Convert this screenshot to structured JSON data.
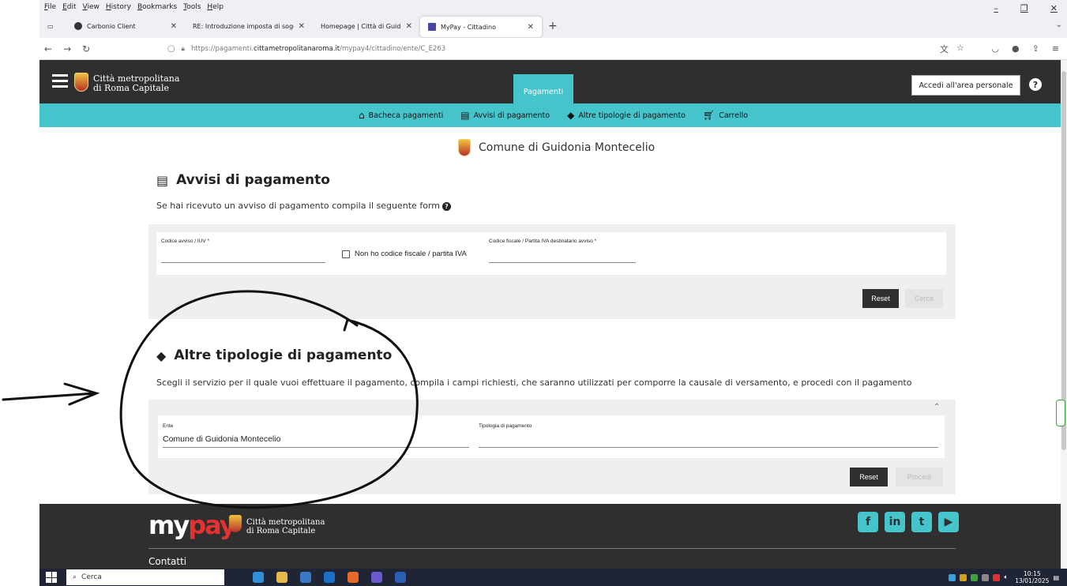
{
  "browser": {
    "menu": [
      "File",
      "Edit",
      "View",
      "History",
      "Bookmarks",
      "Tools",
      "Help"
    ],
    "tabs": [
      {
        "label": "Carbonio Client"
      },
      {
        "label": "RE: Introduzione imposta di soggior"
      },
      {
        "label": "Homepage | Città di Guidonia I"
      },
      {
        "label": "MyPay - Cittadino"
      }
    ],
    "url_prefix": "https://pagamenti.",
    "url_domain": "cittametropolitanaroma.it",
    "url_path": "/mypay4/cittadino/ente/C_E263"
  },
  "header": {
    "brand_line1": "Città metropolitana",
    "brand_line2": "di Roma Capitale",
    "active_tab": "Pagamenti",
    "login_button": "Accedi all'area personale",
    "help": "?"
  },
  "subnav": [
    {
      "label": "Bacheca pagamenti",
      "icon": "home-icon"
    },
    {
      "label": "Avvisi di pagamento",
      "icon": "document-icon"
    },
    {
      "label": "Altre tipologie di pagamento",
      "icon": "tags-icon"
    },
    {
      "label": "Carrello",
      "icon": "cart-icon"
    }
  ],
  "ente_title": "Comune di Guidonia Montecelio",
  "avvisi": {
    "title": "Avvisi di pagamento",
    "subtitle": "Se hai ricevuto un avviso di pagamento compila il seguente form",
    "field1_label": "Codice avviso / IUV *",
    "checkbox_label": "Non ho codice fiscale / partita IVA",
    "field2_label": "Codice fiscale / Partita IVA destinatario avviso *",
    "reset": "Reset",
    "search": "Cerca"
  },
  "altre": {
    "title": "Altre tipologie di pagamento",
    "subtitle": "Scegli il servizio per il quale vuoi effettuare il pagamento, compila i campi richiesti, che saranno utilizzati per comporre la causale di versamento, e procedi con il pagamento",
    "ente_label": "Ente",
    "ente_value": "Comune di Guidonia Montecelio",
    "tipologia_label": "Tipologia di pagamento",
    "reset": "Reset",
    "proceed": "Procedi"
  },
  "footer": {
    "logo_my": "my",
    "logo_pay": "pay",
    "brand_line1": "Città metropolitana",
    "brand_line2": "di Roma Capitale",
    "socials": [
      "f",
      "in",
      "t",
      "▶"
    ],
    "contatti": "Contatti"
  },
  "taskbar": {
    "search_placeholder": "Cerca",
    "time": "10:15",
    "date": "13/01/2025"
  },
  "colors": {
    "teal": "#46c4cc",
    "dark": "#2f2f2f",
    "red": "#e5312f"
  }
}
